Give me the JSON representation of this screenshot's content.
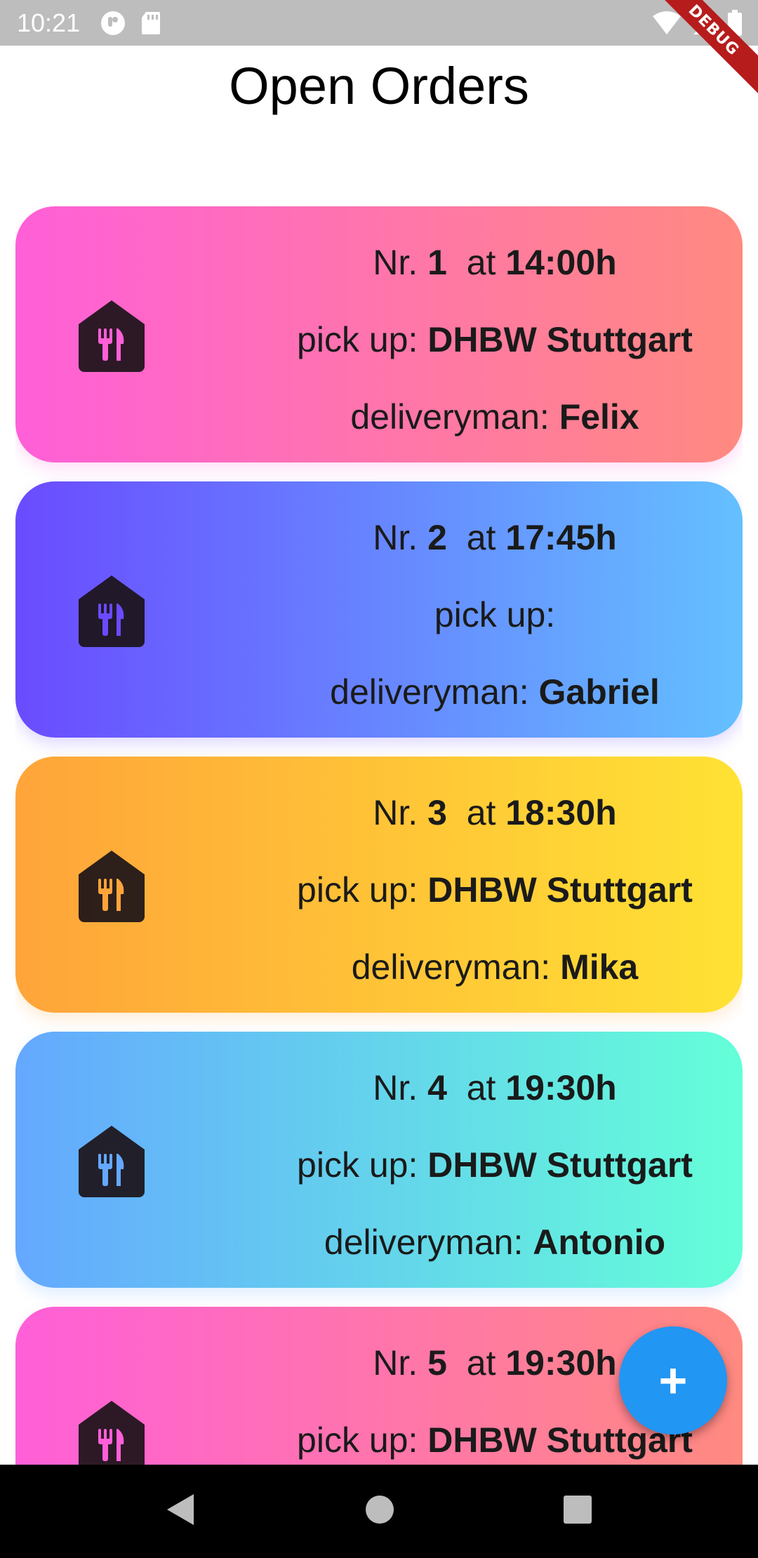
{
  "status_bar": {
    "time": "10:21"
  },
  "debug_banner": "DEBUG",
  "page": {
    "title": "Open Orders"
  },
  "order_labels": {
    "nr": "Nr.",
    "at": "at",
    "pickup": "pick up:",
    "deliveryman": "deliveryman:"
  },
  "orders": [
    {
      "nr": "1",
      "time": "14:00h",
      "pickup": "DHBW Stuttgart",
      "deliveryman": "Felix",
      "gradient": [
        "#ff5fd8",
        "#ff8a80"
      ],
      "icon_color": "#ff5fd8"
    },
    {
      "nr": "2",
      "time": "17:45h",
      "pickup": "",
      "deliveryman": "Gabriel",
      "gradient": [
        "#6a4bff",
        "#64c0ff"
      ],
      "icon_color": "#6a4bff"
    },
    {
      "nr": "3",
      "time": "18:30h",
      "pickup": "DHBW Stuttgart",
      "deliveryman": "Mika",
      "gradient": [
        "#ffa43a",
        "#ffe234"
      ],
      "icon_color": "#ffa43a"
    },
    {
      "nr": "4",
      "time": "19:30h",
      "pickup": "DHBW Stuttgart",
      "deliveryman": "Antonio",
      "gradient": [
        "#64a8ff",
        "#64ffd8"
      ],
      "icon_color": "#64a8ff"
    },
    {
      "nr": "5",
      "time": "19:30h",
      "pickup": "DHBW Stuttgart",
      "deliveryman": "",
      "gradient": [
        "#ff5fd8",
        "#ff8a80"
      ],
      "icon_color": "#ff5fd8"
    }
  ],
  "fab": {
    "label": "+",
    "icon": "add-icon",
    "color": "#2196f3"
  },
  "nav": {
    "icons": [
      "back-icon",
      "home-icon",
      "recents-icon"
    ]
  }
}
